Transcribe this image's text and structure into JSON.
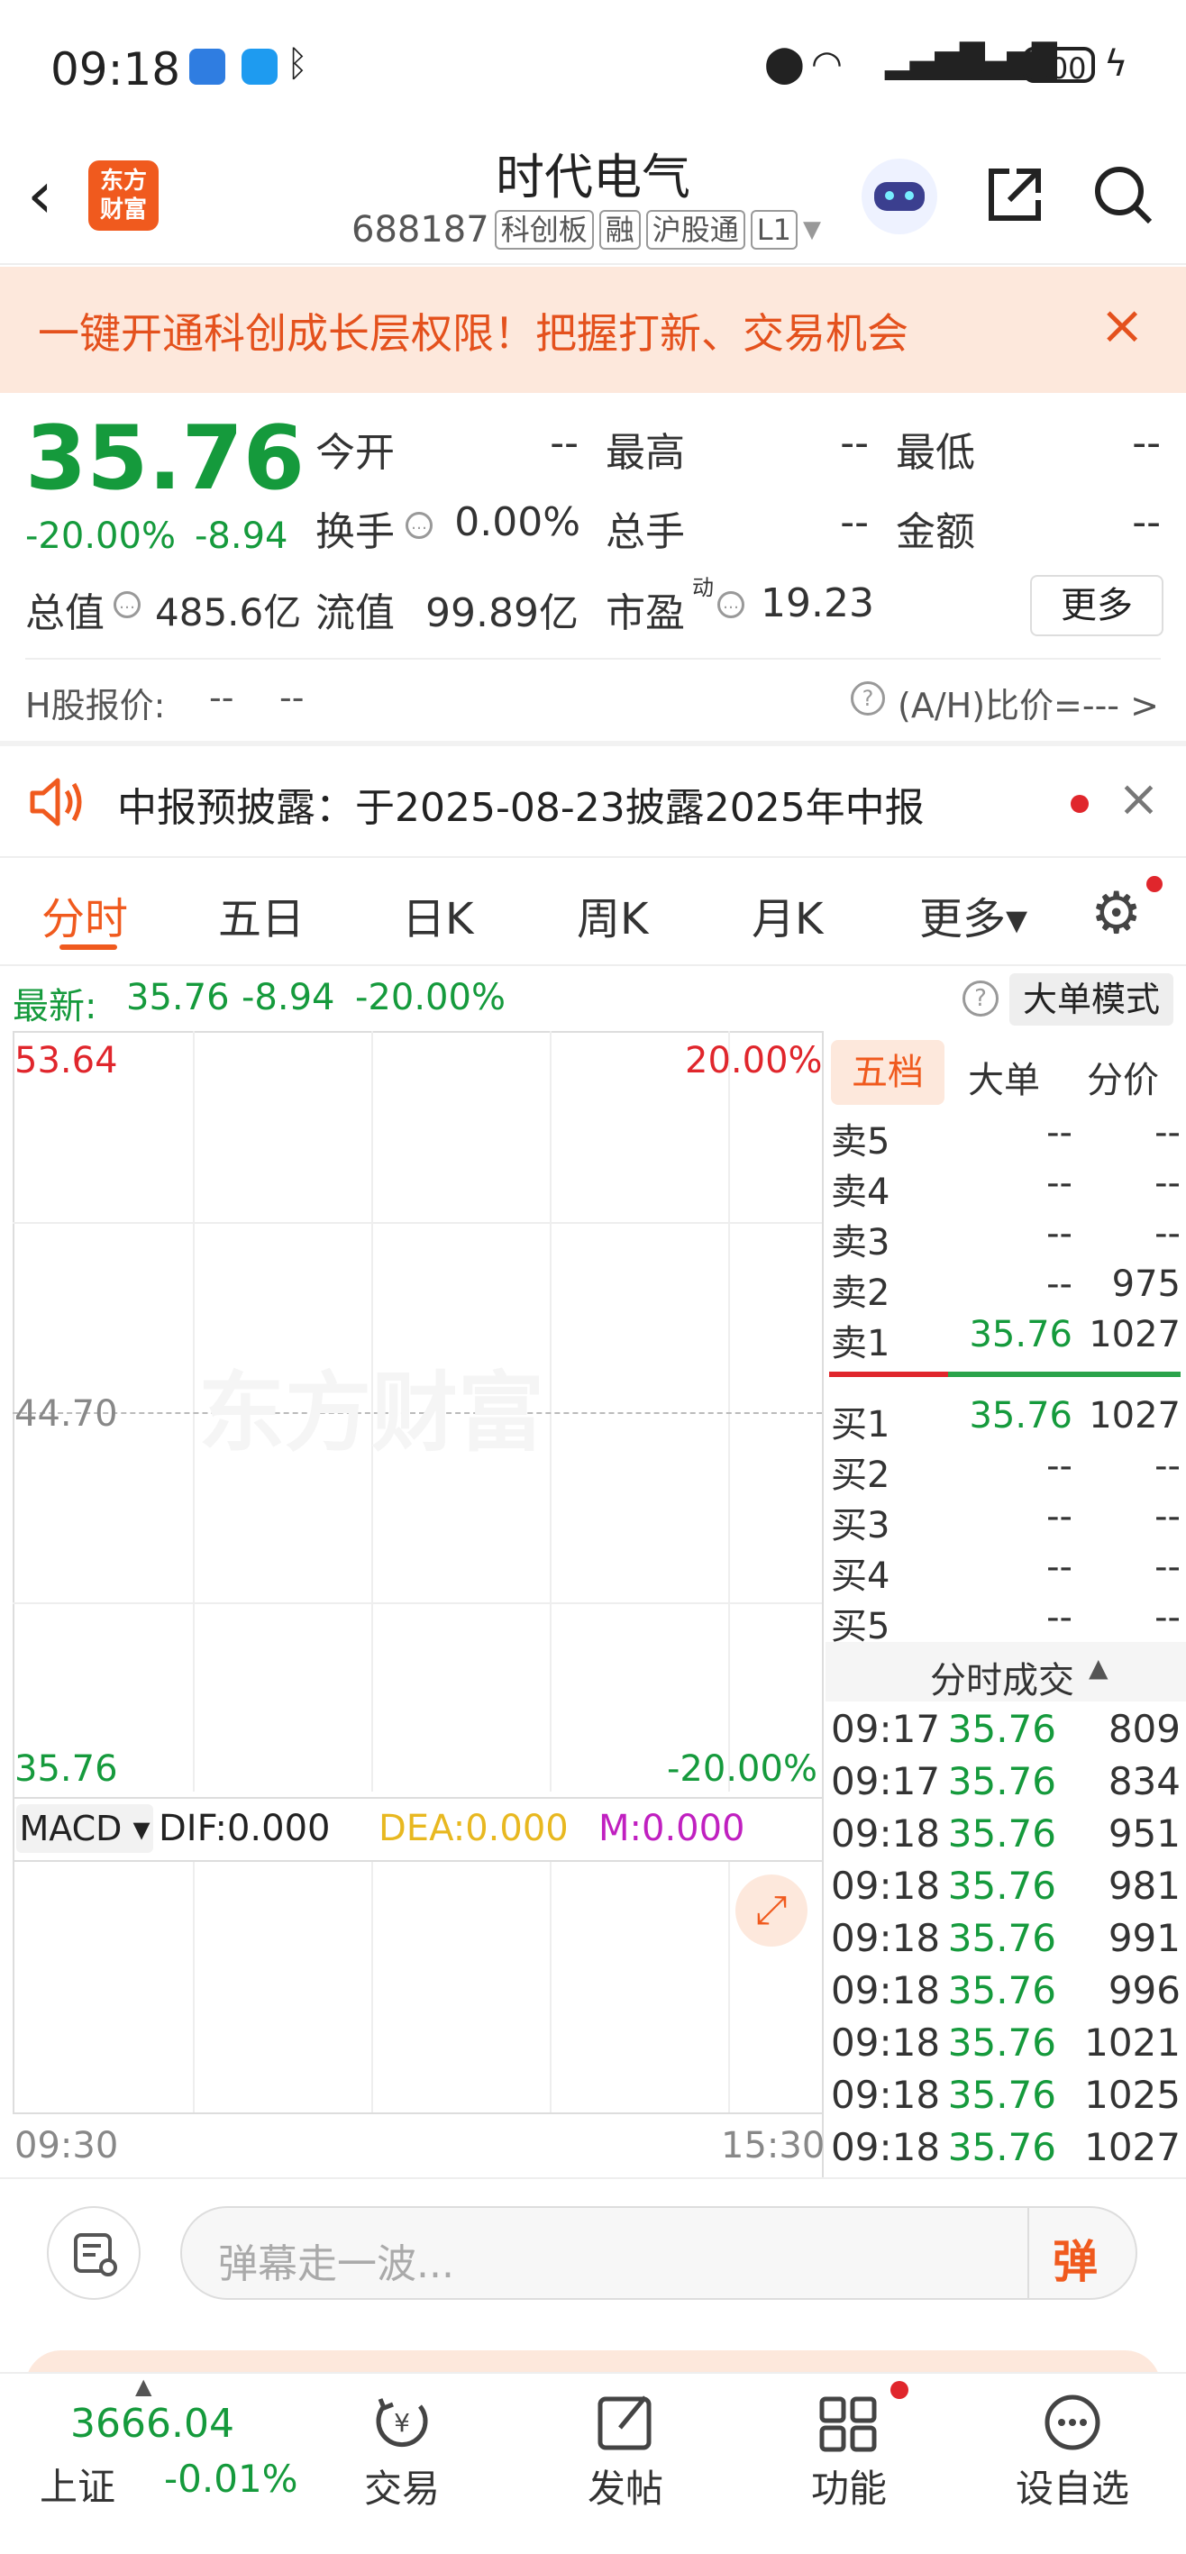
{
  "status_bar": {
    "time": "09:18",
    "battery": "100"
  },
  "header": {
    "logo_line1": "东方",
    "logo_line2": "财富",
    "title": "时代电气",
    "code": "688187",
    "tags": [
      "科创板",
      "融",
      "沪股通",
      "L1"
    ]
  },
  "banner": {
    "text": "一键开通科创成长层权限！把握打新、交易机会"
  },
  "quote": {
    "price": "35.76",
    "change_pct": "-20.00%",
    "change": "-8.94",
    "open_label": "今开",
    "open_value": "--",
    "high_label": "最高",
    "high_value": "--",
    "low_label": "最低",
    "low_value": "--",
    "turnover_label": "换手",
    "turnover_value": "0.00%",
    "volume_label": "总手",
    "volume_value": "--",
    "amount_label": "金额",
    "amount_value": "--",
    "mcap_label": "总值",
    "mcap_value": "485.6亿",
    "float_label": "流值",
    "float_value": "99.89亿",
    "pe_label": "市盈",
    "pe_sup": "动",
    "pe_value": "19.23",
    "more_label": "更多",
    "h_share_label": "H股报价:",
    "h_share_value1": "--",
    "h_share_value2": "--",
    "ah_ratio": "(A/H)比价=--- >"
  },
  "notice": {
    "text": "中报预披露：于2025-08-23披露2025年中报"
  },
  "tabs": [
    "分时",
    "五日",
    "日K",
    "周K",
    "月K",
    "更多▾"
  ],
  "latest": {
    "label": "最新:",
    "price": "35.76",
    "change": "-8.94",
    "pct": "-20.00%",
    "mode_button": "大单模式"
  },
  "chart": {
    "top_price": "53.64",
    "top_pct": "20.00%",
    "mid_price": "44.70",
    "bottom_price": "35.76",
    "bottom_pct": "-20.00%",
    "watermark": "东方财富",
    "time_start": "09:30",
    "time_end": "15:30"
  },
  "macd": {
    "selector": "MACD ▾",
    "dif": "DIF:0.000",
    "dea": "DEA:0.000",
    "m": "M:0.000"
  },
  "orderbook": {
    "tabs": [
      "五档",
      "大单",
      "分价"
    ],
    "asks": [
      {
        "label": "卖5",
        "price": "--",
        "vol": "--"
      },
      {
        "label": "卖4",
        "price": "--",
        "vol": "--"
      },
      {
        "label": "卖3",
        "price": "--",
        "vol": "--"
      },
      {
        "label": "卖2",
        "price": "--",
        "vol": "975"
      },
      {
        "label": "卖1",
        "price": "35.76",
        "vol": "1027"
      }
    ],
    "bids": [
      {
        "label": "买1",
        "price": "35.76",
        "vol": "1027"
      },
      {
        "label": "买2",
        "price": "--",
        "vol": "--"
      },
      {
        "label": "买3",
        "price": "--",
        "vol": "--"
      },
      {
        "label": "买4",
        "price": "--",
        "vol": "--"
      },
      {
        "label": "买5",
        "price": "--",
        "vol": "--"
      }
    ],
    "trades_title": "分时成交",
    "trades": [
      {
        "time": "09:17",
        "price": "35.76",
        "vol": "809"
      },
      {
        "time": "09:17",
        "price": "35.76",
        "vol": "834"
      },
      {
        "time": "09:18",
        "price": "35.76",
        "vol": "951"
      },
      {
        "time": "09:18",
        "price": "35.76",
        "vol": "981"
      },
      {
        "time": "09:18",
        "price": "35.76",
        "vol": "991"
      },
      {
        "time": "09:18",
        "price": "35.76",
        "vol": "996"
      },
      {
        "time": "09:18",
        "price": "35.76",
        "vol": "1021"
      },
      {
        "time": "09:18",
        "price": "35.76",
        "vol": "1025"
      },
      {
        "time": "09:18",
        "price": "35.76",
        "vol": "1027"
      }
    ]
  },
  "danmu": {
    "placeholder": "弹幕走一波...",
    "send": "弹"
  },
  "bottom_nav": {
    "index_value": "3666.04",
    "index_name": "上证",
    "index_pct": "-0.01%",
    "items": [
      "交易",
      "发帖",
      "功能",
      "设自选"
    ]
  },
  "colors": {
    "up": "#e0262c",
    "down": "#159a3c",
    "accent": "#f05a1e"
  }
}
